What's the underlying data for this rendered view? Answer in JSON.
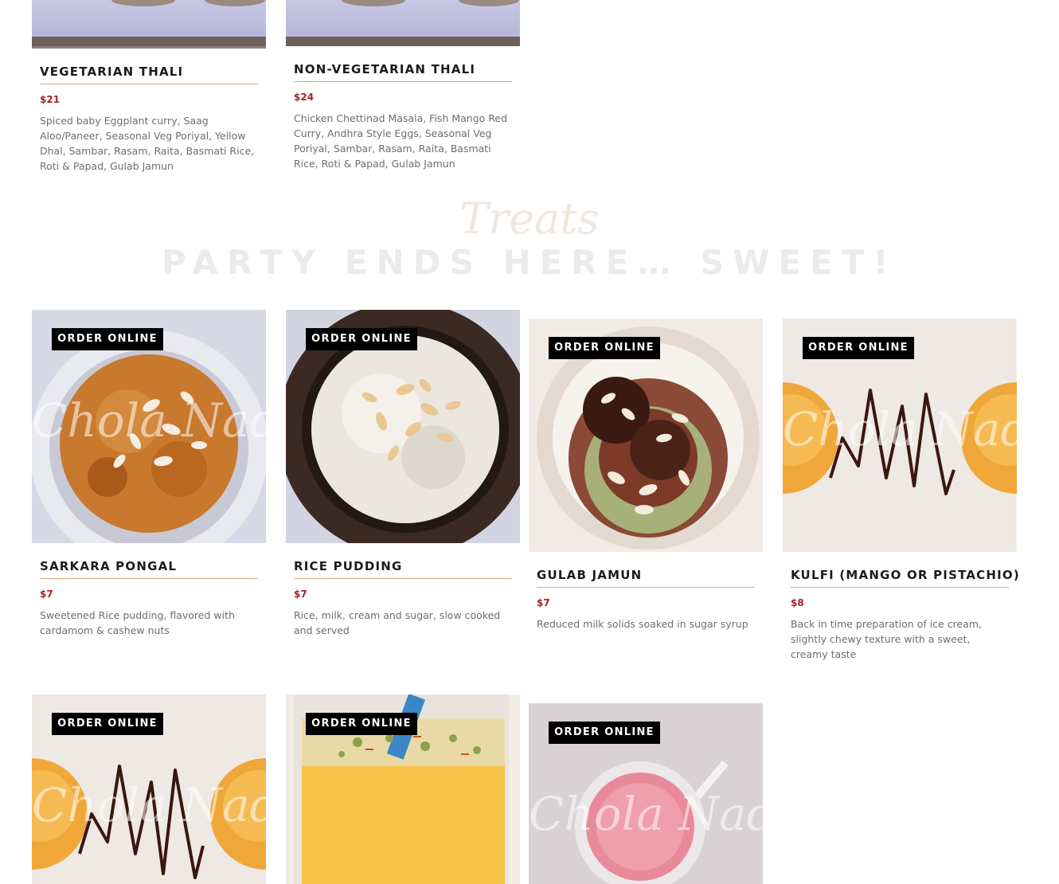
{
  "top_items": [
    {
      "name": "Vegetarian Thali",
      "price": "$21",
      "description": "Spiced baby Eggplant curry, Saag Aloo/Paneer, Seasonal Veg Poriyal, Yellow Dhal, Sambar, Rasam, Raita, Basmati Rice, Roti & Papad, Gulab Jamun"
    },
    {
      "name": "Non-Vegetarian Thali",
      "price": "$24",
      "description": "Chicken Chettinad Masala, Fish Mango Red Curry, Andhra Style Eggs, Seasonal Veg Poriyal, Sambar, Rasam, Raita, Basmati Rice, Roti & Papad, Gulab Jamun"
    }
  ],
  "section": {
    "script_title": "Treats",
    "title": "PARTY ENDS HERE… SWEET!"
  },
  "order_label": "ORDER ONLINE",
  "watermark": "Chola Nad",
  "treats": [
    {
      "name": "Sarkara Pongal",
      "price": "$7",
      "description": "Sweetened Rice pudding, flavored with cardamom & cashew nuts"
    },
    {
      "name": "Rice Pudding",
      "price": "$7",
      "description": "Rice, milk, cream and sugar, slow cooked and served"
    },
    {
      "name": "Gulab Jamun",
      "price": "$7",
      "description": "Reduced milk solids soaked in sugar syrup"
    },
    {
      "name": "Kulfi (Mango or Pistachio)",
      "price": "$8",
      "description": "Back in time preparation of ice cream, slightly chewy texture with a sweet, creamy taste"
    }
  ],
  "bottom_row": [
    {
      "image": "kulfi-plate"
    },
    {
      "image": "mango-lassi"
    },
    {
      "image": "rose-milk"
    }
  ],
  "colors": {
    "price": "#a52323",
    "divider": "#d9a778",
    "button_bg": "#000000",
    "heading": "#ebebeb"
  }
}
